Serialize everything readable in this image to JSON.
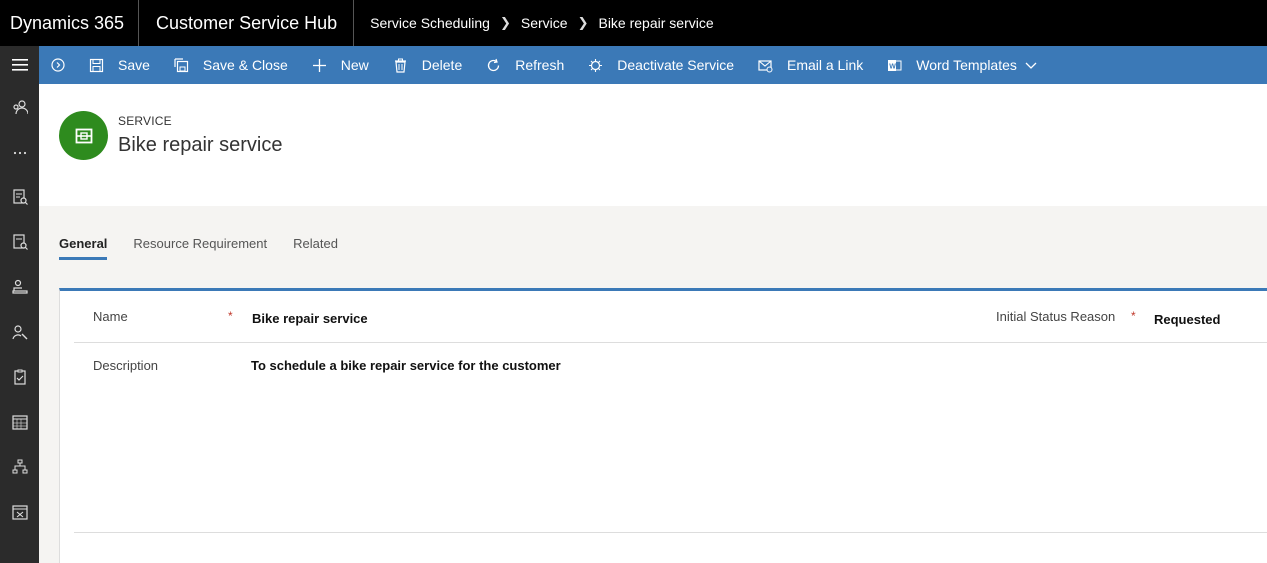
{
  "topbar": {
    "brand": "Dynamics 365",
    "app_name": "Customer Service Hub",
    "breadcrumb": [
      "Service Scheduling",
      "Service",
      "Bike repair service"
    ]
  },
  "sidebar": {
    "items": [
      "contacts-icon",
      "more-icon",
      "report-icon",
      "report-search-icon",
      "person-desk-icon",
      "person-wrench-icon",
      "clipboard-icon",
      "calendar-icon",
      "org-chart-icon",
      "calendar-x-icon"
    ]
  },
  "commands": {
    "save": "Save",
    "save_close": "Save & Close",
    "new": "New",
    "delete": "Delete",
    "refresh": "Refresh",
    "deactivate": "Deactivate Service",
    "email_link": "Email a Link",
    "word_templates": "Word Templates"
  },
  "header": {
    "entity_type": "SERVICE",
    "title": "Bike repair service"
  },
  "tabs": [
    "General",
    "Resource Requirement",
    "Related"
  ],
  "form": {
    "name_label": "Name",
    "name_value": "Bike repair service",
    "status_label": "Initial Status Reason",
    "status_value": "Requested",
    "required_mark": "*",
    "description_label": "Description",
    "description_value": "To schedule a bike repair service for the customer"
  },
  "colors": {
    "accent": "#3b79b7",
    "entity_icon": "#2e8b1e",
    "topbar": "#000000",
    "sidebar": "#2b2b2b"
  }
}
